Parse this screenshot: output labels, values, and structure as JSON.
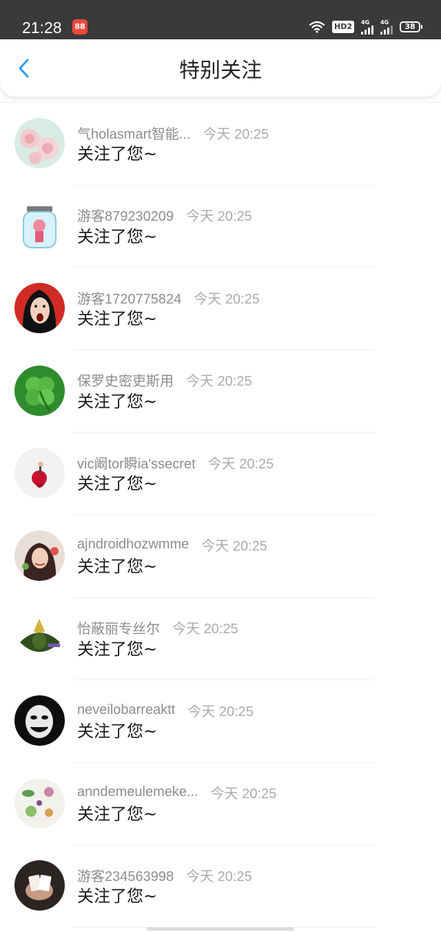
{
  "status_bar": {
    "time": "21:28",
    "app_badge": "88",
    "hd_label": "HD2",
    "signal_1": "4G",
    "signal_2": "4G",
    "battery": "38"
  },
  "header": {
    "title": "特别关注",
    "back_icon": "chevron-left-icon"
  },
  "colors": {
    "accent": "#2a9df4",
    "name_text": "#8d8d8d",
    "time_text": "#ababab",
    "message_text": "#1a1a1a",
    "status_bar_bg": "#3a3a3a"
  },
  "notifications": [
    {
      "name": "气holasmart智能...",
      "time": "今天 20:25",
      "message": "关注了您~",
      "avatar": "pink-roses-avatar"
    },
    {
      "name": "游客879230209",
      "time": "今天 20:25",
      "message": "关注了您~",
      "avatar": "girl-in-jar-avatar"
    },
    {
      "name": "游客1720775824",
      "time": "今天 20:25",
      "message": "关注了您~",
      "avatar": "screaming-woman-avatar"
    },
    {
      "name": "保罗史密吏斯用",
      "time": "今天 20:25",
      "message": "关注了您~",
      "avatar": "four-leaf-clover-avatar"
    },
    {
      "name": "vic阚tor瞬ia'ssecret",
      "time": "今天 20:25",
      "message": "关注了您~",
      "avatar": "red-rose-avatar"
    },
    {
      "name": "ajndroidhozwmme",
      "time": "今天 20:25",
      "message": "关注了您~",
      "avatar": "woman-portrait-avatar"
    },
    {
      "name": "怡蔽丽专丝尔",
      "time": "今天 20:25",
      "message": "关注了您~",
      "avatar": "masked-warrior-avatar"
    },
    {
      "name": "neveilobarreaktt",
      "time": "今天 20:25",
      "message": "关注了您~",
      "avatar": "dark-mask-avatar"
    },
    {
      "name": "anndemeulemeke...",
      "time": "今天 20:25",
      "message": "关注了您~",
      "avatar": "botanical-avatar"
    },
    {
      "name": "游客234563998",
      "time": "今天 20:25",
      "message": "关注了您~",
      "avatar": "hand-cards-avatar"
    }
  ]
}
